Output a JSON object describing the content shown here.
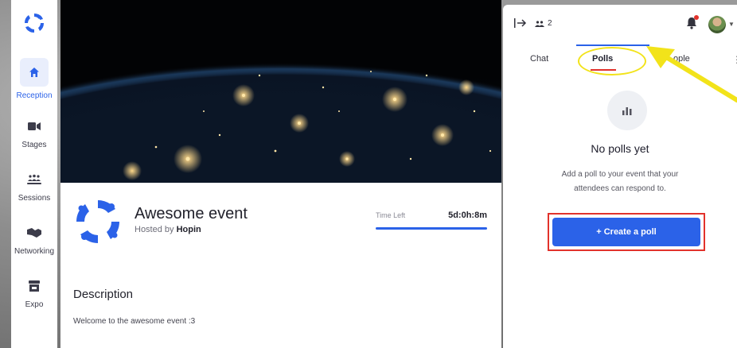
{
  "sidebar": {
    "items": [
      {
        "label": "Reception",
        "icon": "home-icon",
        "active": true
      },
      {
        "label": "Stages",
        "icon": "video-camera-icon"
      },
      {
        "label": "Sessions",
        "icon": "people-group-icon"
      },
      {
        "label": "Networking",
        "icon": "handshake-icon"
      },
      {
        "label": "Expo",
        "icon": "booth-icon"
      }
    ]
  },
  "event": {
    "title": "Awesome event",
    "host_prefix": "Hosted by",
    "host_name": "Hopin",
    "timer_label": "Time Left",
    "timer_value": "5d:0h:8m",
    "description_title": "Description",
    "description_text": "Welcome to the awesome event :3"
  },
  "panel": {
    "people_count": "2",
    "tabs": [
      {
        "label": "Chat"
      },
      {
        "label": "Polls",
        "active": true
      },
      {
        "label": "ople"
      }
    ],
    "empty_title": "No polls yet",
    "empty_text": "Add a poll to your event that your attendees can respond to.",
    "create_button": "+ Create a poll"
  },
  "colors": {
    "accent": "#2b62e8",
    "annotation_red": "#e2322b",
    "annotation_yellow": "#f2e31a"
  }
}
